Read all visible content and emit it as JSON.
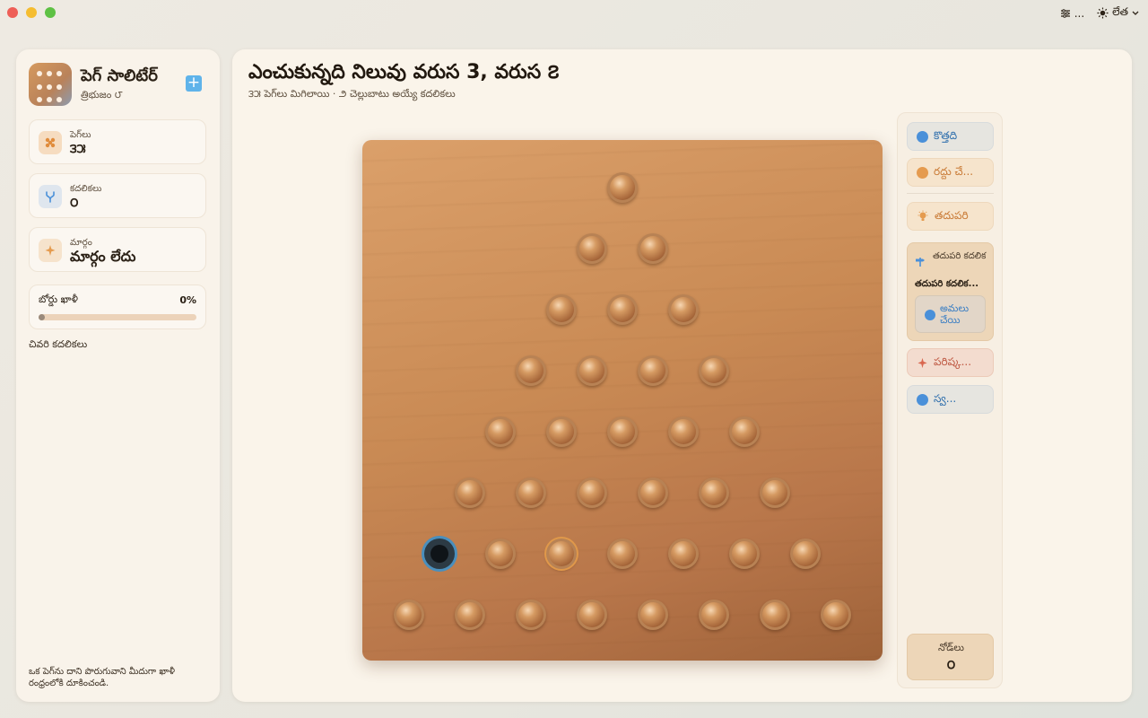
{
  "titlebar": {
    "settings_label": "...",
    "theme_label": "లేత"
  },
  "sidebar": {
    "app_title": "పెగ్ సాలిటేర్",
    "app_subtitle": "త్రిభుజం ౮",
    "add_label": "+",
    "stats": [
      {
        "label": "పెగ్‌లు",
        "value": "౩౫"
      },
      {
        "label": "కదలికలు",
        "value": "౦"
      },
      {
        "label": "మార్గం",
        "value": "మార్గం లేదు"
      }
    ],
    "progress": {
      "label": "బోర్డు ఖాళీ",
      "percent_text": "0%",
      "fraction": 0.0
    },
    "recent_moves_title": "చివరి కదలికలు",
    "hint_text": "ఒక పెగ్‌ను దాని పొరుగువాని మీదుగా ఖాళీ రంధ్రంలోకి దూకించండి."
  },
  "main": {
    "heading": "ఎంచుకున్నది నిలువు వరుస 3, వరుస ౭",
    "subheading": "౩౫ పెగ్‌లు మిగిలాయి · ౨ చెల్లుబాటు అయ్యే కదలికలు"
  },
  "board": {
    "rows": [
      [
        "peg"
      ],
      [
        "peg",
        "peg"
      ],
      [
        "peg",
        "peg",
        "peg"
      ],
      [
        "peg",
        "peg",
        "peg",
        "peg"
      ],
      [
        "peg",
        "peg",
        "peg",
        "peg",
        "peg"
      ],
      [
        "peg",
        "peg",
        "peg",
        "peg",
        "peg",
        "peg"
      ],
      [
        "hole",
        "peg",
        "selected",
        "peg",
        "peg",
        "peg",
        "peg"
      ],
      [
        "peg",
        "peg",
        "peg",
        "peg",
        "peg",
        "peg",
        "peg",
        "peg"
      ]
    ]
  },
  "tools": {
    "new_label": "కొత్తది",
    "undo_label": "రద్దు చే...",
    "next_label": "తదుపరి",
    "next_move_title": "తదుపరి కదలిక",
    "next_move_body": "తదుపరి కదలిక...",
    "apply_label": "అమలు చేయి",
    "solve_label": "పరిష్క...",
    "play_label": "స్వ...",
    "nodes_label": "నోడ్‌లు",
    "nodes_value": "౦"
  },
  "colors": {
    "accent_blue": "#4a90d9",
    "accent_orange": "#e59b4f",
    "board_wood": "#c98a54",
    "selection_ring": "#4a8fbd"
  }
}
